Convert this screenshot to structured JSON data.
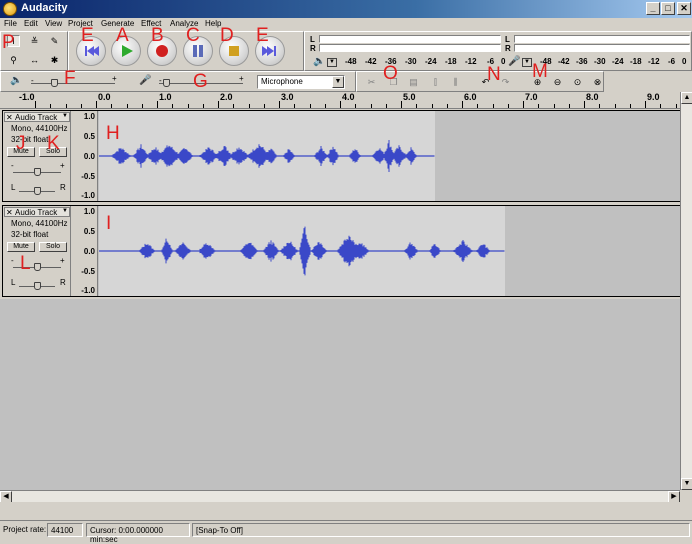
{
  "window": {
    "title": "Audacity"
  },
  "menu": [
    "File",
    "Edit",
    "View",
    "Project",
    "Generate",
    "Effect",
    "Analyze",
    "Help"
  ],
  "meters": {
    "play_channels": [
      "L",
      "R"
    ],
    "rec_channels": [
      "L",
      "R"
    ],
    "scale_labels": [
      "-48",
      "-42",
      "-36",
      "-30",
      "-24",
      "-18",
      "-12",
      "-6",
      "0"
    ]
  },
  "mixer": {
    "input_source": "Microphone"
  },
  "ruler": {
    "ticks": [
      "-1.0",
      "0.0",
      "1.0",
      "2.0",
      "3.0",
      "4.0",
      "5.0",
      "6.0",
      "7.0",
      "8.0",
      "9.0"
    ]
  },
  "tracks": [
    {
      "name": "Audio Track",
      "format": "Mono, 44100Hz",
      "bits": "32-bit float",
      "mute": "Mute",
      "solo": "Solo",
      "gain_minus": "-",
      "gain_plus": "+",
      "pan_left": "L",
      "pan_right": "R",
      "scale": [
        "1.0",
        "0.5",
        "0.0",
        "-0.5",
        "-1.0"
      ],
      "end_seconds": 5.5
    },
    {
      "name": "Audio Track",
      "format": "Mono, 44100Hz",
      "bits": "32-bit float",
      "mute": "Mute",
      "solo": "Solo",
      "gain_minus": "-",
      "gain_plus": "+",
      "pan_left": "L",
      "pan_right": "R",
      "scale": [
        "1.0",
        "0.5",
        "0.0",
        "-0.5",
        "-1.0"
      ],
      "end_seconds": 6.7
    }
  ],
  "status": {
    "rate_label": "Project rate:",
    "rate_value": "44100",
    "cursor": "Cursor: 0:00.000000 min:sec",
    "snap": "[Snap-To Off]"
  },
  "annotations": [
    "A",
    "B",
    "C",
    "D",
    "E",
    "E",
    "F",
    "G",
    "H",
    "I",
    "J",
    "K",
    "L",
    "M",
    "N",
    "O",
    "P"
  ],
  "colors": {
    "waveform": "#3a48c8",
    "titlebar": "#0a246a",
    "annotation": "#e02020"
  }
}
